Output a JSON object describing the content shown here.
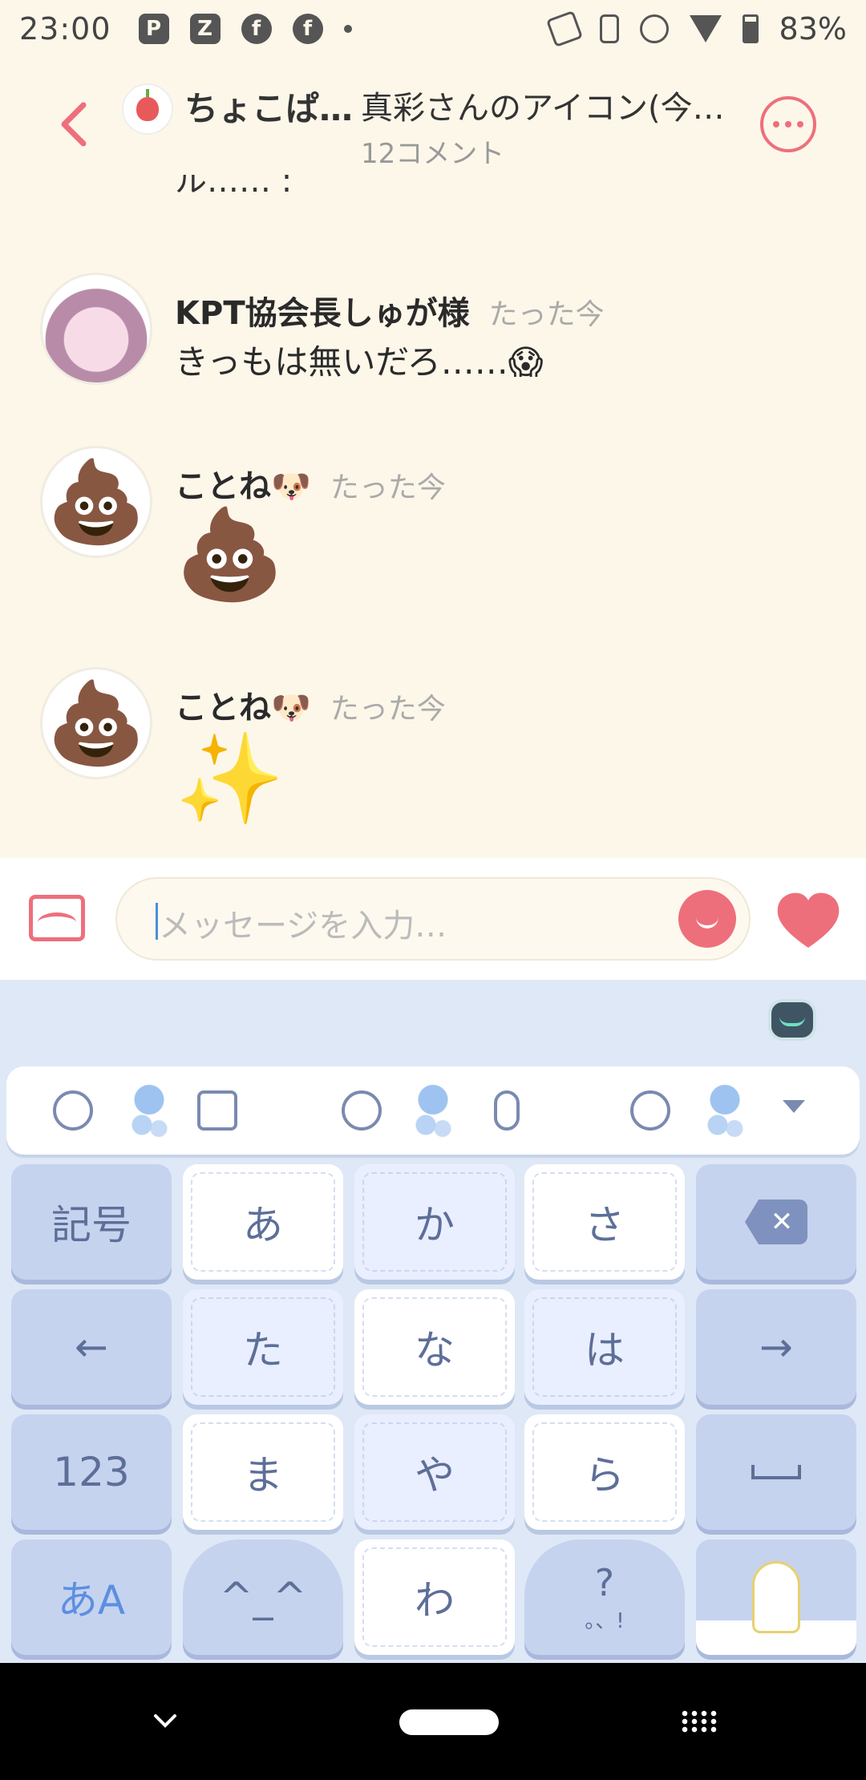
{
  "status_bar": {
    "time": "23:00",
    "battery": "83%",
    "left_icons": [
      "P",
      "Z",
      "f",
      "f"
    ]
  },
  "header": {
    "community_name": "ちょこぱ…",
    "post_title": "真彩さんのアイコン(今…",
    "comment_count": "12コメント"
  },
  "truncated_text": "ル…… :",
  "comments": [
    {
      "name": "KPT協会長しゅが様",
      "time": "たった今",
      "text": "きっもは無いだろ……😱"
    },
    {
      "name": "ことね🐶",
      "time": "たった今",
      "text": "💩"
    },
    {
      "name": "ことね🐶",
      "time": "たった今",
      "text": "✨"
    }
  ],
  "input": {
    "placeholder": "メッセージを入力…"
  },
  "keyboard": {
    "rows": [
      [
        "記号",
        "あ",
        "か",
        "さ",
        "⌫"
      ],
      [
        "←",
        "た",
        "な",
        "は",
        "→"
      ],
      [
        "123",
        "ま",
        "や",
        "ら",
        "␣"
      ],
      [
        "あA",
        "^_^",
        "わ",
        "?。、!",
        ""
      ]
    ],
    "symbol_key": "記号",
    "number_key": "123",
    "mode_key": "あA",
    "left_arrow": "←",
    "right_arrow": "→",
    "delete_glyph": "✕",
    "face_key": "^_^",
    "punct_key_q": "?",
    "punct_key_marks": "。、!",
    "a": "あ",
    "ka": "か",
    "sa": "さ",
    "ta": "た",
    "na": "な",
    "ha": "は",
    "ma": "ま",
    "ya": "や",
    "ra": "ら",
    "wa": "わ"
  },
  "colors": {
    "accent": "#ee6f7c",
    "background": "#fdf7ea",
    "keyboard_bg": "#dfe8f6"
  }
}
